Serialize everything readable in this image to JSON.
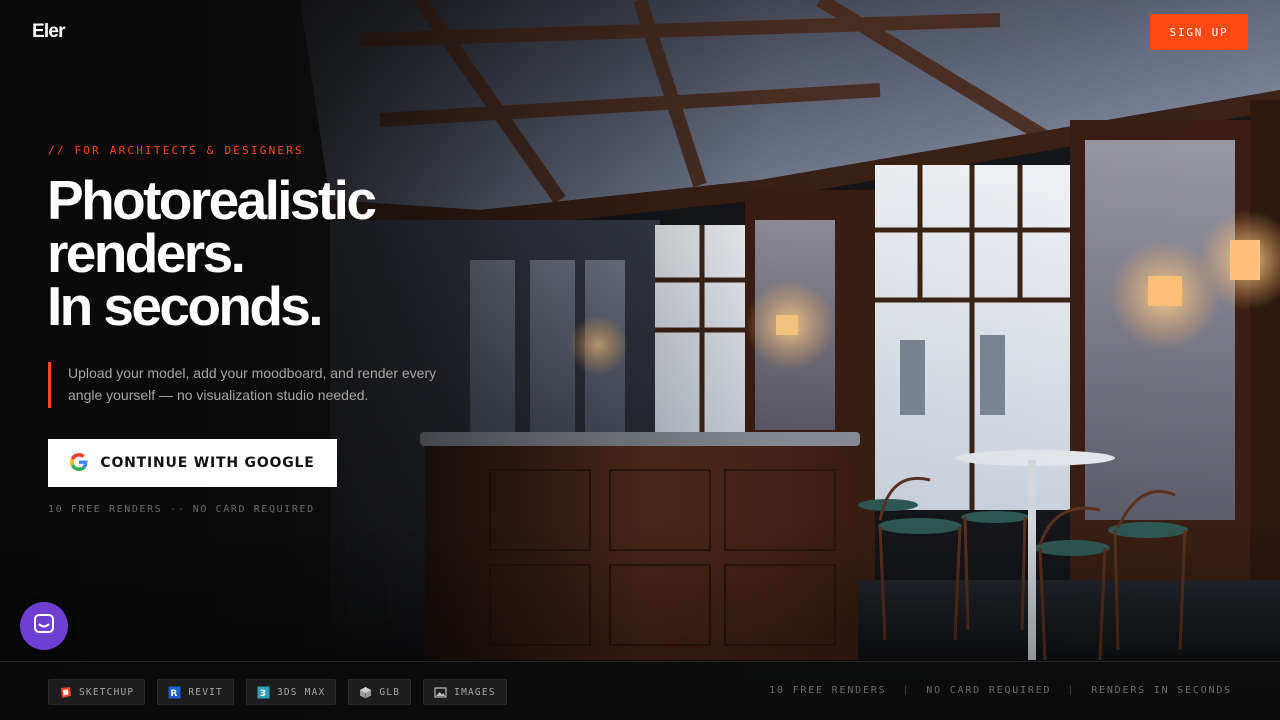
{
  "brand": {
    "name": "Eler",
    "accent": "#ff4b12"
  },
  "header": {
    "signup_label": "SIGN UP"
  },
  "hero": {
    "eyebrow": "// FOR ARCHITECTS & DESIGNERS",
    "headline_lines": [
      "Photorealistic",
      "renders.",
      "In seconds."
    ],
    "description": "Upload your model, add your moodboard, and render every angle yourself — no visualization studio needed.",
    "cta_label": "CONTINUE WITH GOOGLE",
    "fine_print": "10 FREE RENDERS -- NO CARD REQUIRED"
  },
  "chat": {
    "icon": "chat-icon",
    "color": "#6f3fd0"
  },
  "footer": {
    "formats": [
      {
        "label": "SKETCHUP",
        "icon": "sketchup-icon"
      },
      {
        "label": "REVIT",
        "icon": "revit-icon"
      },
      {
        "label": "3DS MAX",
        "icon": "3dsmax-icon"
      },
      {
        "label": "GLB",
        "icon": "cube-icon"
      },
      {
        "label": "IMAGES",
        "icon": "image-icon"
      }
    ],
    "stats": [
      "10 FREE RENDERS",
      "NO CARD REQUIRED",
      "RENDERS IN SECONDS"
    ],
    "separator": "|"
  }
}
